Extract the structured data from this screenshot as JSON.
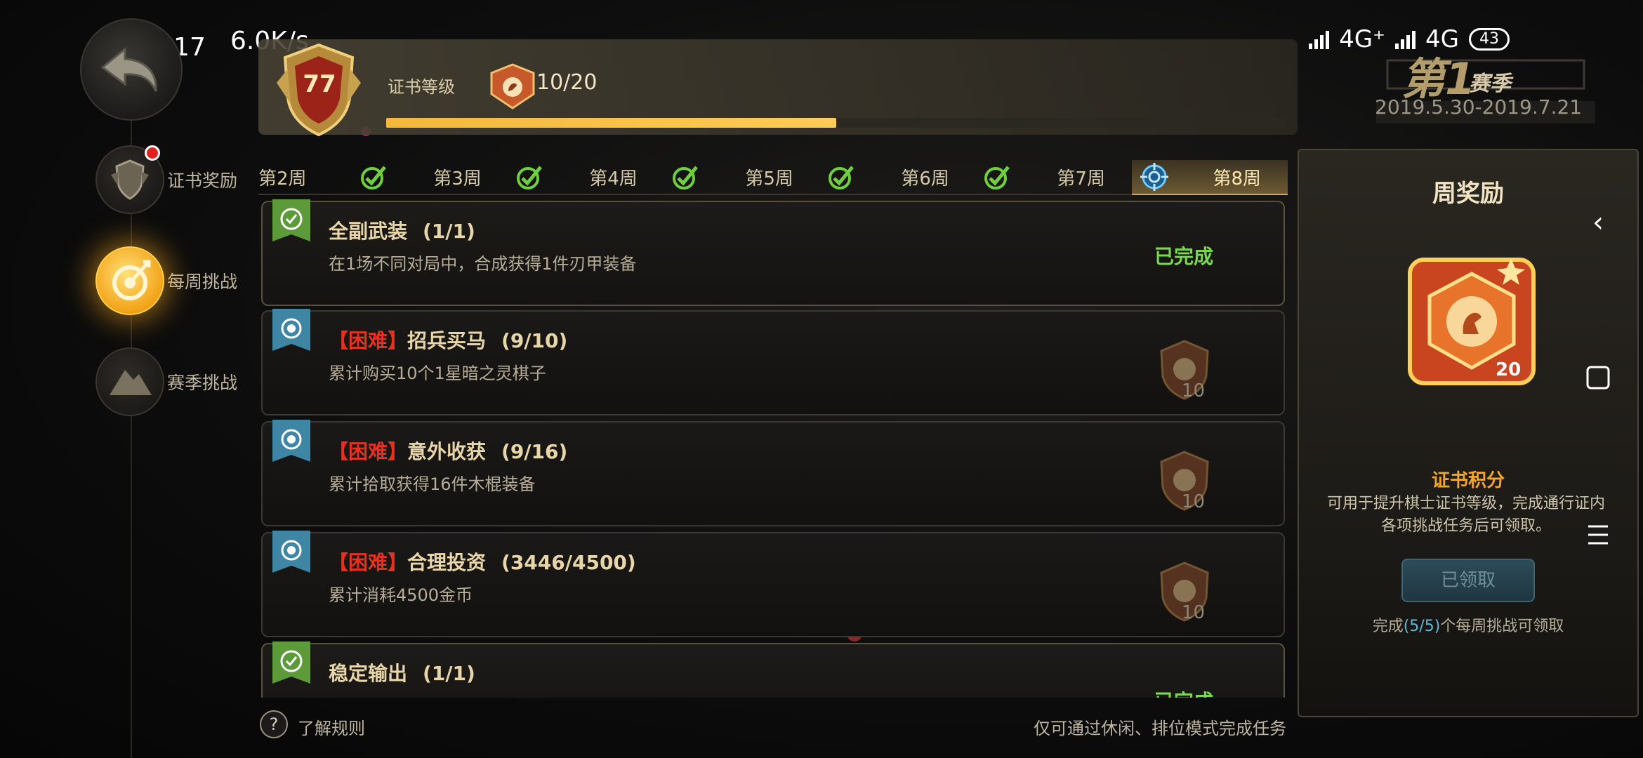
{
  "status_bar": {
    "time": "上午6:17",
    "speed": "6.0K/s",
    "signal1": "4G⁺",
    "signal2": "4G",
    "battery": "43"
  },
  "nav": {
    "items": [
      {
        "label": "证书奖励",
        "icon": "shield-icon",
        "active": false,
        "has_dot": true
      },
      {
        "label": "每周挑战",
        "icon": "target-icon",
        "active": true,
        "has_dot": false
      },
      {
        "label": "赛季挑战",
        "icon": "mountain-icon",
        "active": false,
        "has_dot": false
      }
    ]
  },
  "header": {
    "level": "77",
    "cert_label": "证书等级",
    "progress_text": "10/20",
    "progress_fraction": 0.5,
    "season_number": "第1",
    "season_word": "赛季",
    "season_dates": "2019.5.30-2019.7.21"
  },
  "weeks": [
    {
      "label": "第2周",
      "state": "done"
    },
    {
      "label": "第3周",
      "state": "done"
    },
    {
      "label": "第4周",
      "state": "done"
    },
    {
      "label": "第5周",
      "state": "done"
    },
    {
      "label": "第6周",
      "state": "done"
    },
    {
      "label": "第7周",
      "state": "done"
    },
    {
      "label": "第8周",
      "state": "active"
    }
  ],
  "tasks": [
    {
      "prefix": "",
      "title": "全副武装",
      "count": "(1/1)",
      "desc": "在1场不同对局中，合成获得1件刃甲装备",
      "status": "已完成",
      "reward": ""
    },
    {
      "prefix": "【困难】",
      "title": "招兵买马",
      "count": "(9/10)",
      "desc": "累计购买10个1星暗之灵棋子",
      "status": "",
      "reward": "10"
    },
    {
      "prefix": "【困难】",
      "title": "意外收获",
      "count": "(9/16)",
      "desc": "累计拾取获得16件木棍装备",
      "status": "",
      "reward": "10"
    },
    {
      "prefix": "【困难】",
      "title": "合理投资",
      "count": "(3446/4500)",
      "desc": "累计消耗4500金币",
      "status": "",
      "reward": "10"
    },
    {
      "prefix": "",
      "title": "稳定输出",
      "count": "(1/1)",
      "desc": "",
      "status": "已完成",
      "reward": ""
    }
  ],
  "footer": {
    "help_icon": "?",
    "help_label": "了解规则",
    "note": "仅可通过休闲、排位模式完成任务"
  },
  "reward_panel": {
    "title": "周奖励",
    "medal_value": "20",
    "subtitle": "证书积分",
    "desc": "可用于提升棋士证书等级，完成通行证内各项挑战任务后可领取。",
    "button": "已领取",
    "cond_prefix": "完成",
    "cond_hl": "(5/5)",
    "cond_suffix": "个每周挑战可领取"
  },
  "colors": {
    "accent_gold": "#f2a52a",
    "done_green": "#7ad94f",
    "hard_red": "#e8301c"
  }
}
